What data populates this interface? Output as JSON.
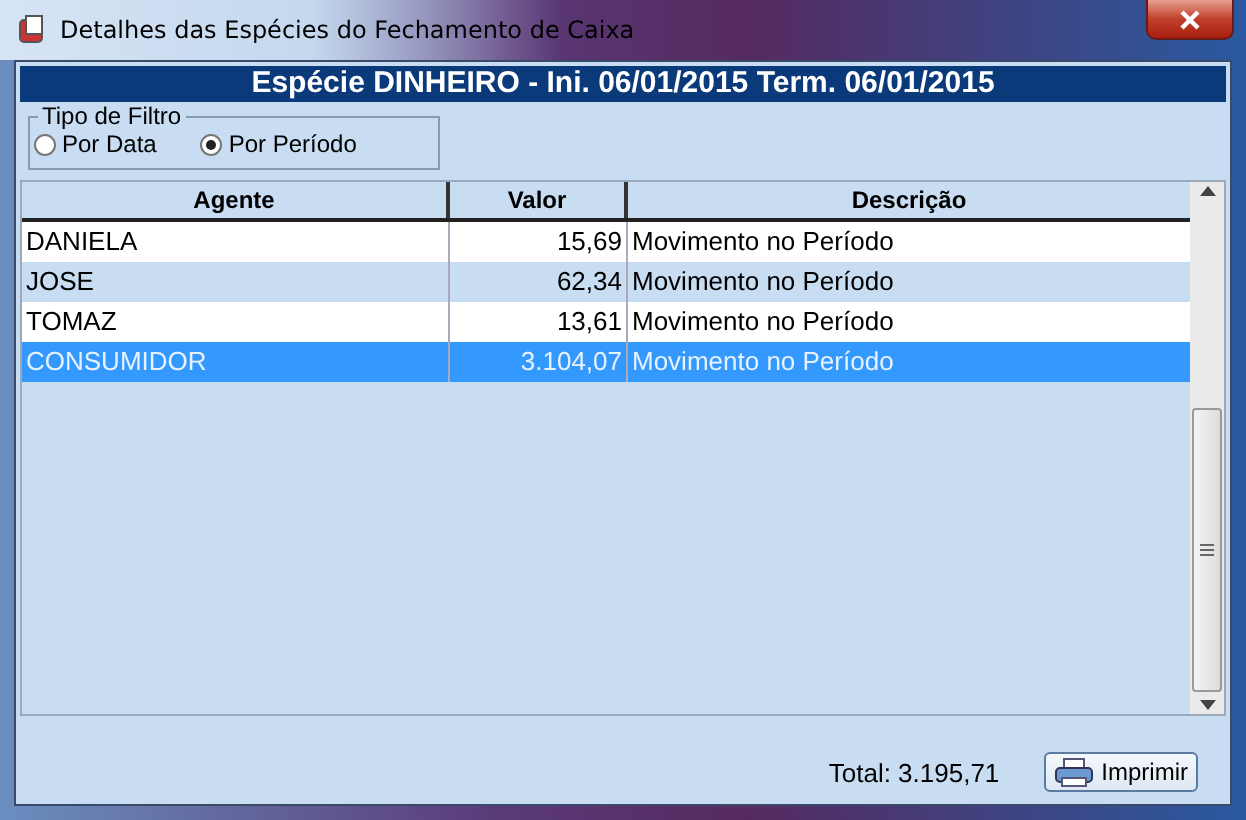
{
  "window": {
    "title": "Detalhes das Espécies do Fechamento de Caixa"
  },
  "header": "Espécie DINHEIRO - Ini. 06/01/2015 Term. 06/01/2015",
  "filter": {
    "title": "Tipo de Filtro",
    "options": [
      {
        "label": "Por Data",
        "selected": false
      },
      {
        "label": "Por Período",
        "selected": true
      }
    ]
  },
  "table": {
    "columns": [
      "Agente",
      "Valor",
      "Descrição"
    ],
    "rows": [
      {
        "cells": [
          "DANIELA",
          "15,69",
          "Movimento no Período"
        ],
        "selected": false
      },
      {
        "cells": [
          "JOSE",
          "62,34",
          "Movimento no Período"
        ],
        "selected": false
      },
      {
        "cells": [
          "TOMAZ",
          "13,61",
          "Movimento no Período"
        ],
        "selected": false
      },
      {
        "cells": [
          "CONSUMIDOR",
          "3.104,07",
          "Movimento no Período"
        ],
        "selected": true
      }
    ]
  },
  "footer": {
    "total": "Total: 3.195,71",
    "button": "Imprimir"
  }
}
